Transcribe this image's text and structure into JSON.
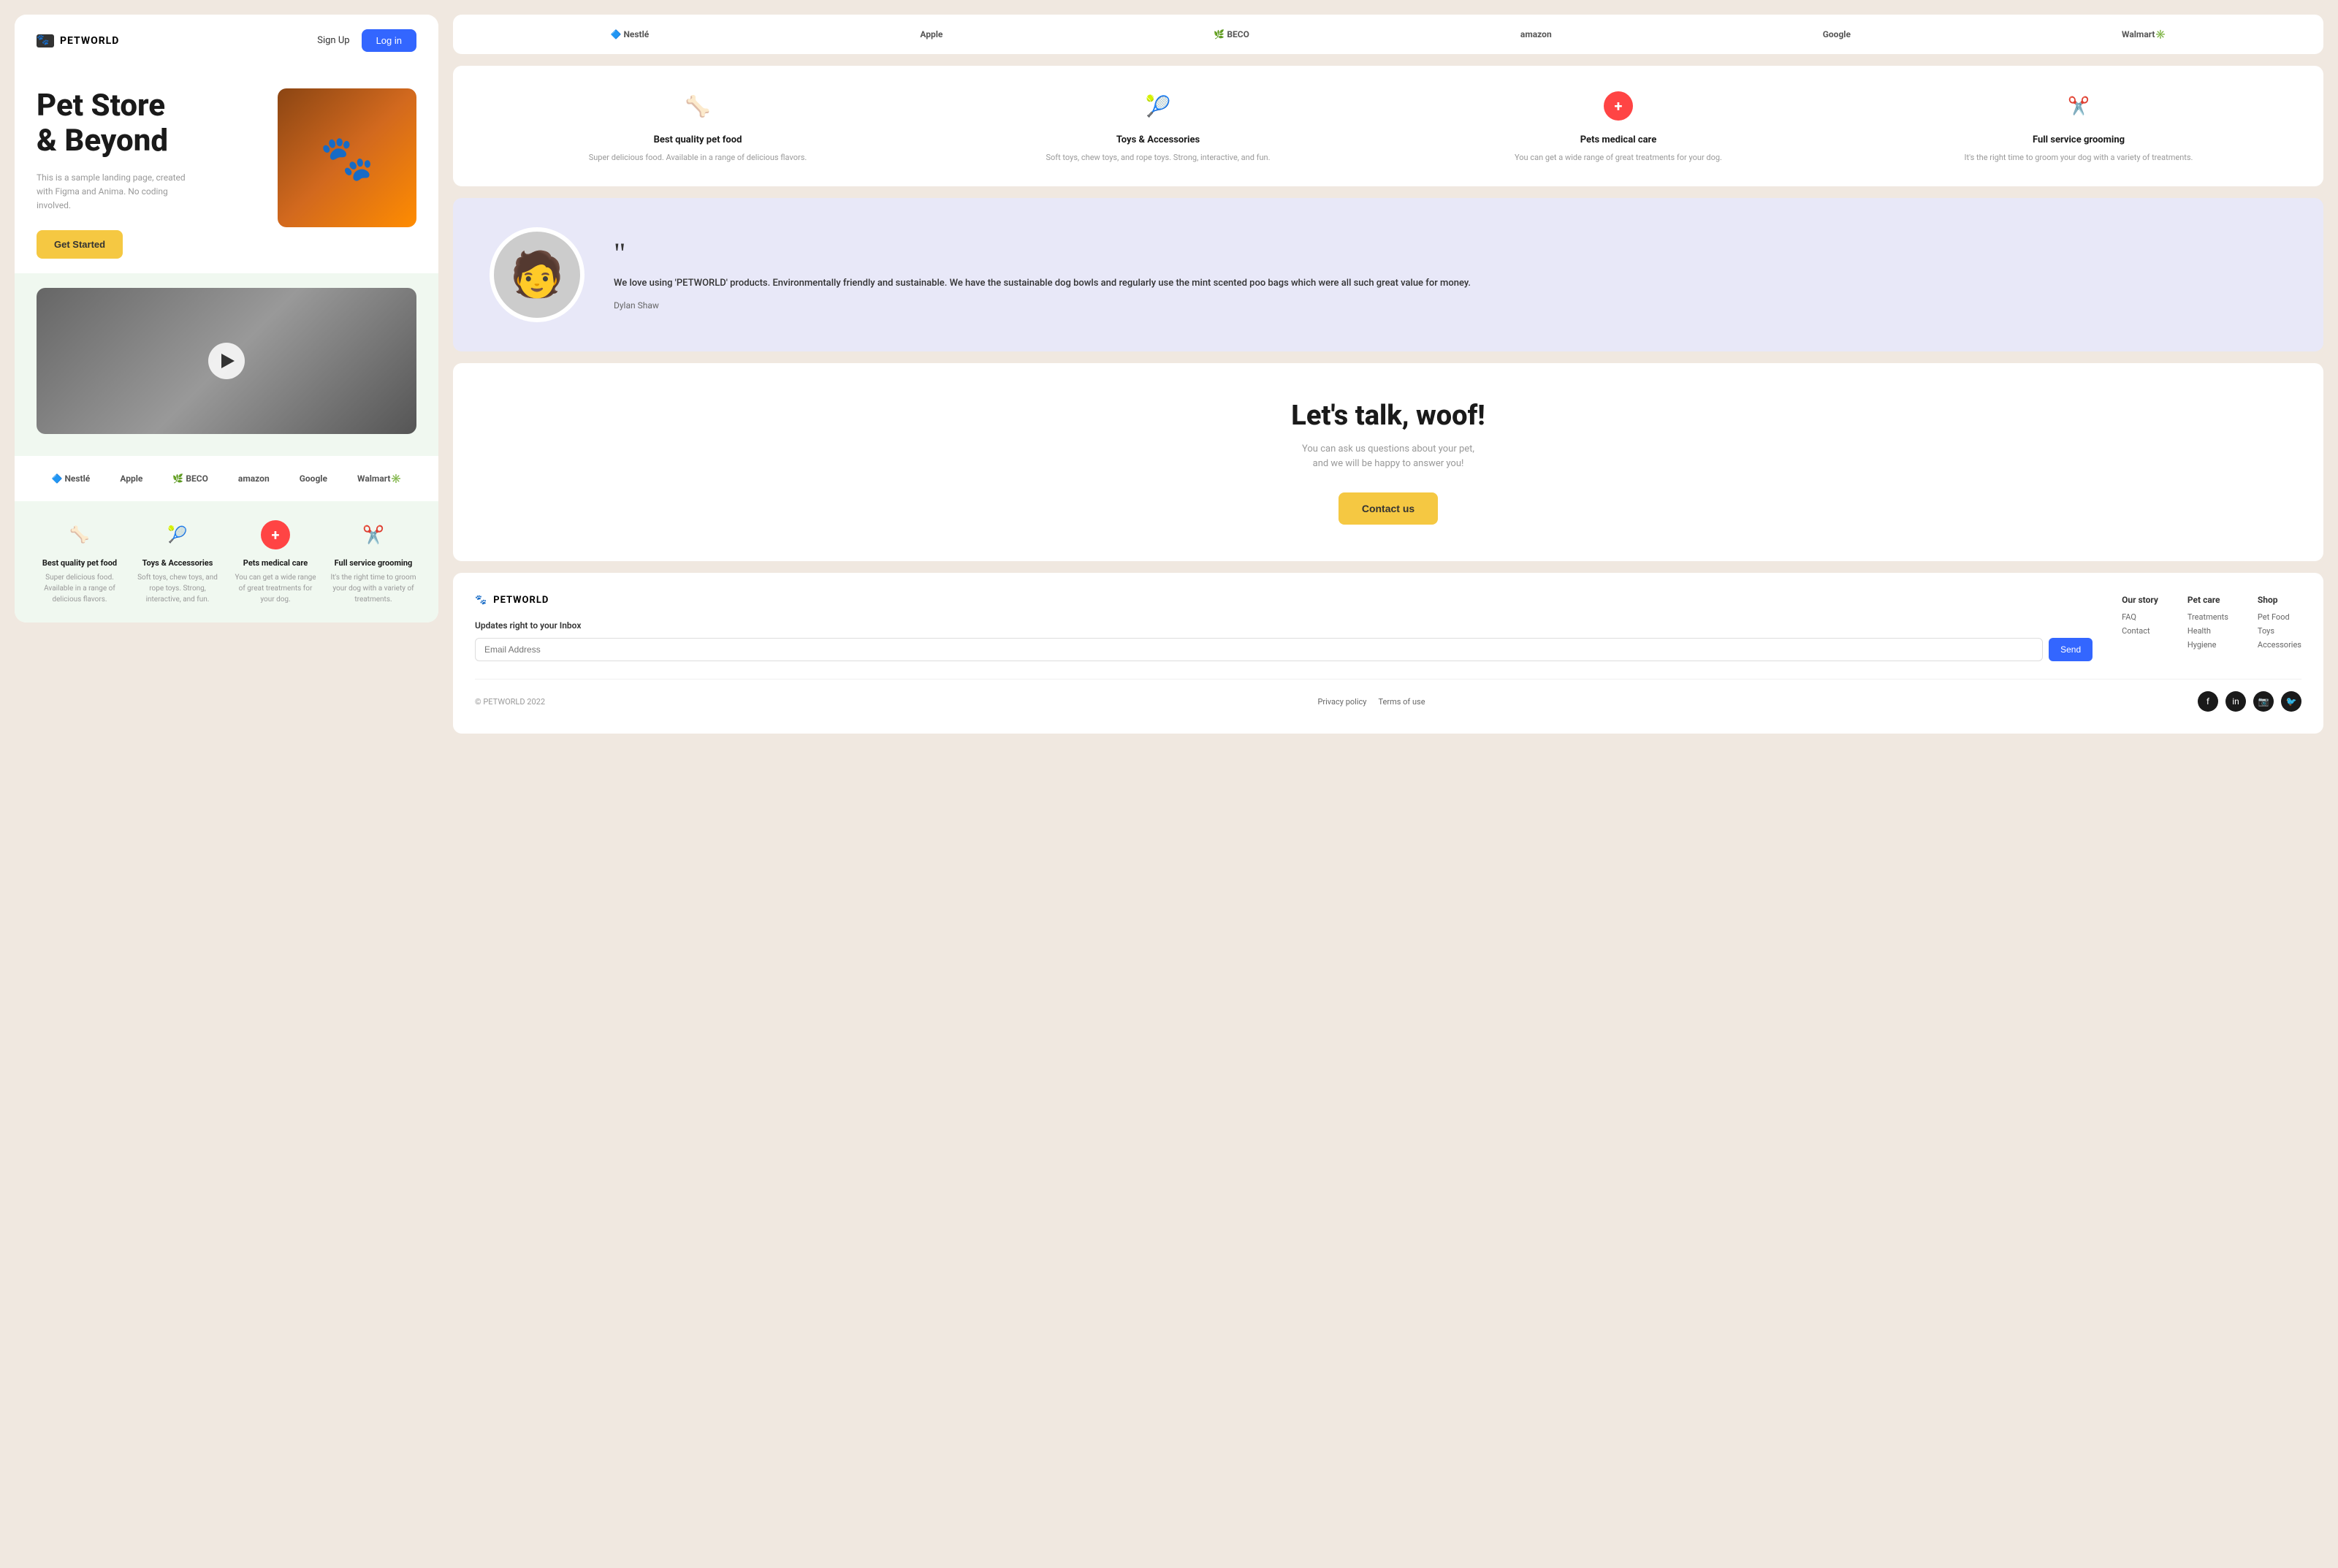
{
  "app": {
    "name": "PETWORLD",
    "tagline": "Pet Store & Beyond"
  },
  "header": {
    "signup_label": "Sign Up",
    "login_label": "Log in",
    "logo_text": "PETWORLD"
  },
  "hero": {
    "title_line1": "Pet Store",
    "title_line2": "& Beyond",
    "subtitle": "This is a sample landing page, created with Figma and Anima. No coding involved.",
    "cta_label": "Get Started"
  },
  "brands": [
    {
      "name": "Nestlé",
      "symbol": "🔷"
    },
    {
      "name": "Apple",
      "symbol": ""
    },
    {
      "name": "BECO",
      "symbol": ""
    },
    {
      "name": "amazon",
      "symbol": ""
    },
    {
      "name": "Google",
      "symbol": ""
    },
    {
      "name": "Walmart",
      "symbol": ""
    }
  ],
  "features": [
    {
      "icon": "🦴",
      "title": "Best quality pet food",
      "desc": "Super delicious food. Available in a range of delicious flavors."
    },
    {
      "icon": "🎾",
      "title": "Toys & Accessories",
      "desc": "Soft toys, chew toys, and rope toys. Strong, interactive, and fun."
    },
    {
      "icon": "➕",
      "title": "Pets medical care",
      "desc": "You can get a wide range of great treatments for your dog."
    },
    {
      "icon": "✂️",
      "title": "Full service grooming",
      "desc": "It's the right time to groom your dog with a variety of treatments."
    }
  ],
  "testimonial": {
    "quote": "We love using 'PETWORLD' products. Environmentally friendly and sustainable. We have the sustainable dog bowls and regularly use the mint scented poo bags which were all such great value for money.",
    "author": "Dylan Shaw"
  },
  "cta": {
    "title": "Let's talk, woof!",
    "subtitle_line1": "You can ask us questions about your pet,",
    "subtitle_line2": "and we will be happy to answer you!",
    "button_label": "Contact us"
  },
  "footer": {
    "logo_text": "PETWORLD",
    "newsletter_label": "Updates right to your Inbox",
    "email_placeholder": "Email Address",
    "send_label": "Send",
    "columns": [
      {
        "title": "Our story",
        "links": [
          "FAQ",
          "Contact"
        ]
      },
      {
        "title": "Pet care",
        "links": [
          "Treatments",
          "Health",
          "Hygiene"
        ]
      },
      {
        "title": "Shop",
        "links": [
          "Pet Food",
          "Toys",
          "Accessories"
        ]
      }
    ],
    "copyright": "© PETWORLD 2022",
    "privacy_label": "Privacy policy",
    "terms_label": "Terms of use",
    "social": [
      "f",
      "in",
      "📷",
      "🐦"
    ]
  }
}
